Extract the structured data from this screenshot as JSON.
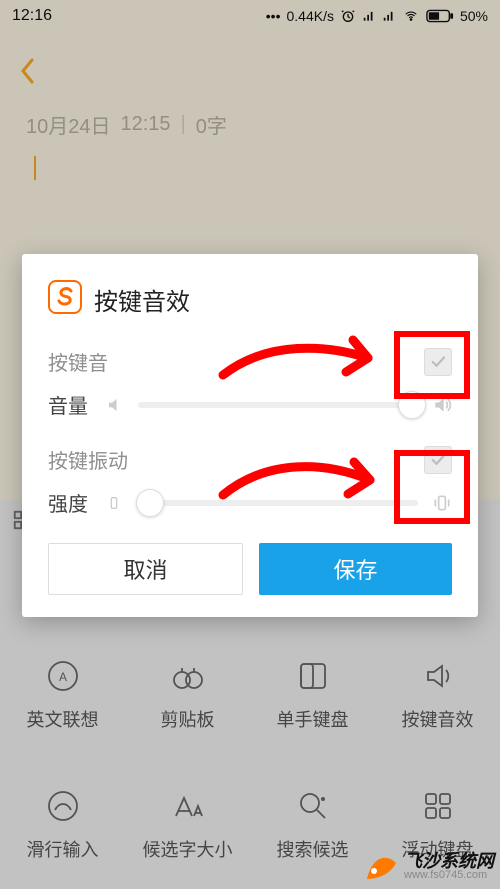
{
  "status": {
    "time": "12:16",
    "net_speed": "0.44K/s",
    "battery_pct": "50%"
  },
  "note": {
    "date": "10月24日",
    "time": "12:15",
    "word_count": "0字"
  },
  "dialog": {
    "title": "按键音效",
    "sound": {
      "label": "按键音",
      "checked": false
    },
    "volume": {
      "label": "音量",
      "value_pct": 98
    },
    "vibrate": {
      "label": "按键振动",
      "checked": false
    },
    "intensity": {
      "label": "强度",
      "value_pct": 5
    },
    "cancel": "取消",
    "save": "保存"
  },
  "keyboard_options": {
    "row1": [
      {
        "id": "assoc",
        "label": "英文联想"
      },
      {
        "id": "clipboard",
        "label": "剪贴板"
      },
      {
        "id": "onehand",
        "label": "单手键盘"
      },
      {
        "id": "keysound",
        "label": "按键音效"
      }
    ],
    "row2": [
      {
        "id": "swipe",
        "label": "滑行输入"
      },
      {
        "id": "candsize",
        "label": "候选字大小"
      },
      {
        "id": "searchcand",
        "label": "搜索候选"
      },
      {
        "id": "floatkb",
        "label": "浮动键盘"
      }
    ]
  },
  "watermark": {
    "brand": "飞沙系统网",
    "url": "www.fs0745.com"
  }
}
